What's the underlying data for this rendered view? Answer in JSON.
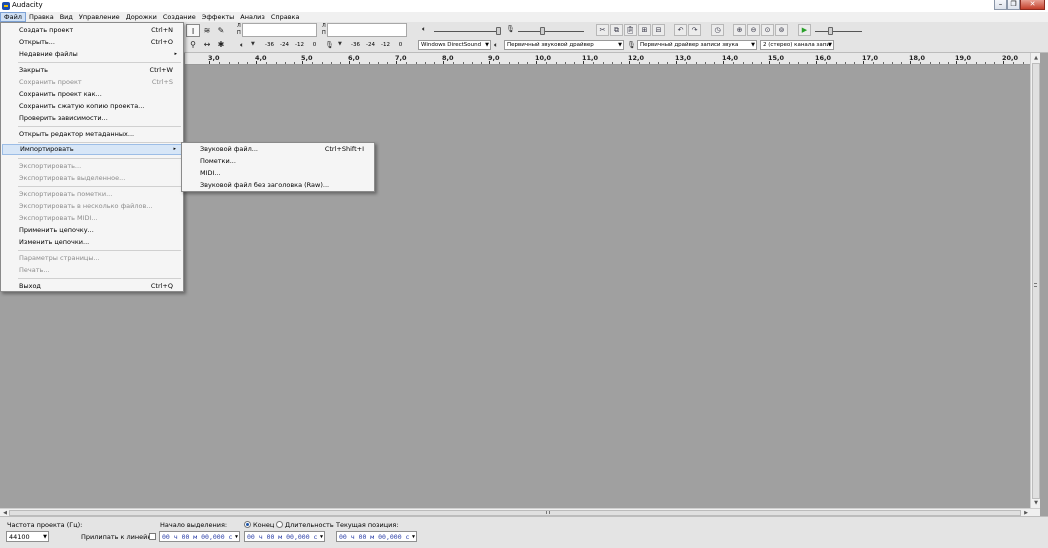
{
  "window": {
    "title": "Audacity",
    "controls": [
      "–",
      "❐",
      "✕"
    ]
  },
  "menubar": [
    "Файл",
    "Правка",
    "Вид",
    "Управление",
    "Дорожки",
    "Создание",
    "Эффекты",
    "Анализ",
    "Справка"
  ],
  "meters": {
    "playback_scale": [
      "-36",
      "-24",
      "-12",
      "0"
    ],
    "record_scale": [
      "-36",
      "-24",
      "-12",
      "0"
    ],
    "channel_letters": [
      "Л",
      "П"
    ]
  },
  "devices": {
    "host": "Windows DirectSound",
    "playback": "Первичный звуковой драйвер",
    "recording": "Первичный драйвер записи звука",
    "channels": "2 (стерео) канала запи"
  },
  "ruler": [
    "3,0",
    "4,0",
    "5,0",
    "6,0",
    "7,0",
    "8,0",
    "9,0",
    "10,0",
    "11,0",
    "12,0",
    "13,0",
    "14,0",
    "15,0",
    "16,0",
    "17,0",
    "18,0",
    "19,0",
    "20,0"
  ],
  "file_menu": {
    "items": [
      {
        "label": "Создать проект",
        "shortcut": "Ctrl+N"
      },
      {
        "label": "Открыть...",
        "shortcut": "Ctrl+O"
      },
      {
        "label": "Недавние файлы",
        "submenu": "▸"
      },
      {
        "label": "Закрыть",
        "shortcut": "Ctrl+W"
      },
      {
        "label": "Сохранить проект",
        "shortcut": "Ctrl+S"
      },
      {
        "label": "Сохранить проект как..."
      },
      {
        "label": "Сохранить сжатую копию проекта..."
      },
      {
        "label": "Проверить зависимости..."
      },
      {
        "label": "Открыть редактор метаданных..."
      },
      {
        "label": "Импортировать",
        "submenu": "▸"
      },
      {
        "label": "Экспортировать..."
      },
      {
        "label": "Экспортировать выделенное..."
      },
      {
        "label": "Экспортировать пометки..."
      },
      {
        "label": "Экспортировать в несколько файлов..."
      },
      {
        "label": "Экспортировать MIDI..."
      },
      {
        "label": "Применить цепочку..."
      },
      {
        "label": "Изменить цепочки..."
      },
      {
        "label": "Параметры страницы..."
      },
      {
        "label": "Печать..."
      },
      {
        "label": "Выход",
        "shortcut": "Ctrl+Q"
      }
    ]
  },
  "import_menu": {
    "items": [
      {
        "label": "Звуковой файл...",
        "shortcut": "Ctrl+Shift+I"
      },
      {
        "label": "Пометки..."
      },
      {
        "label": "MIDI..."
      },
      {
        "label": "Звуковой файл без заголовка (Raw)..."
      }
    ]
  },
  "selection_bar": {
    "rate_label": "Частота проекта (Гц):",
    "rate_value": "44100",
    "snap_label": "Прилипать к линейке",
    "start_label": "Начало выделения:",
    "end_label": "Конец",
    "length_label": "Длительность",
    "position_label": "Текущая позиция:",
    "timecode": "00 ч 00 м 00,000 с"
  }
}
